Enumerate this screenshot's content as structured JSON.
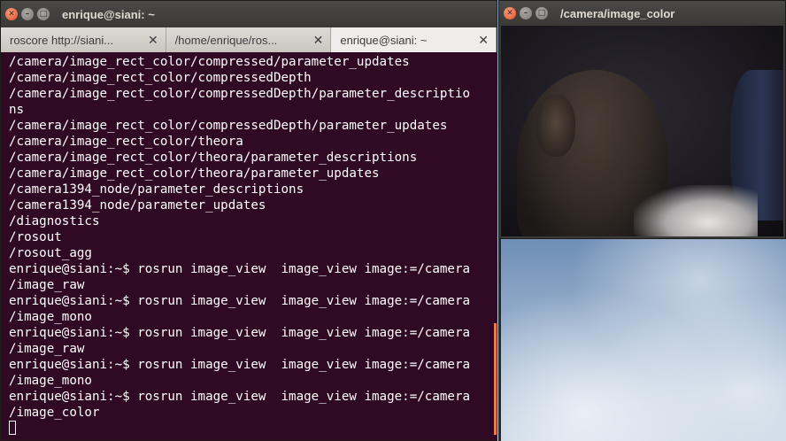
{
  "terminal": {
    "title": "enrique@siani: ~",
    "tabs": [
      {
        "label": "roscore http://siani...",
        "close": "✕"
      },
      {
        "label": "/home/enrique/ros...",
        "close": "✕"
      },
      {
        "label": "enrique@siani: ~",
        "close": "✕"
      }
    ],
    "active_tab": 2,
    "lines": [
      "/camera/image_rect_color/compressed/parameter_updates",
      "/camera/image_rect_color/compressedDepth",
      "/camera/image_rect_color/compressedDepth/parameter_descriptio",
      "ns",
      "/camera/image_rect_color/compressedDepth/parameter_updates",
      "/camera/image_rect_color/theora",
      "/camera/image_rect_color/theora/parameter_descriptions",
      "/camera/image_rect_color/theora/parameter_updates",
      "/camera1394_node/parameter_descriptions",
      "/camera1394_node/parameter_updates",
      "/diagnostics",
      "/rosout",
      "/rosout_agg",
      "enrique@siani:~$ rosrun image_view  image_view image:=/camera",
      "/image_raw",
      "enrique@siani:~$ rosrun image_view  image_view image:=/camera",
      "/image_mono",
      "enrique@siani:~$ rosrun image_view  image_view image:=/camera",
      "/image_raw",
      "enrique@siani:~$ rosrun image_view  image_view image:=/camera",
      "/image_mono",
      "enrique@siani:~$ rosrun image_view  image_view image:=/camera",
      "/image_color"
    ],
    "scroll_position": 1.0
  },
  "image_window": {
    "title": "/camera/image_color"
  },
  "window_buttons": {
    "close": "✕",
    "minimize": "–",
    "maximize": "□"
  },
  "colors": {
    "terminal_bg": "#300a24",
    "close_button": "#df4f26",
    "scroll_thumb": "#f07746"
  }
}
